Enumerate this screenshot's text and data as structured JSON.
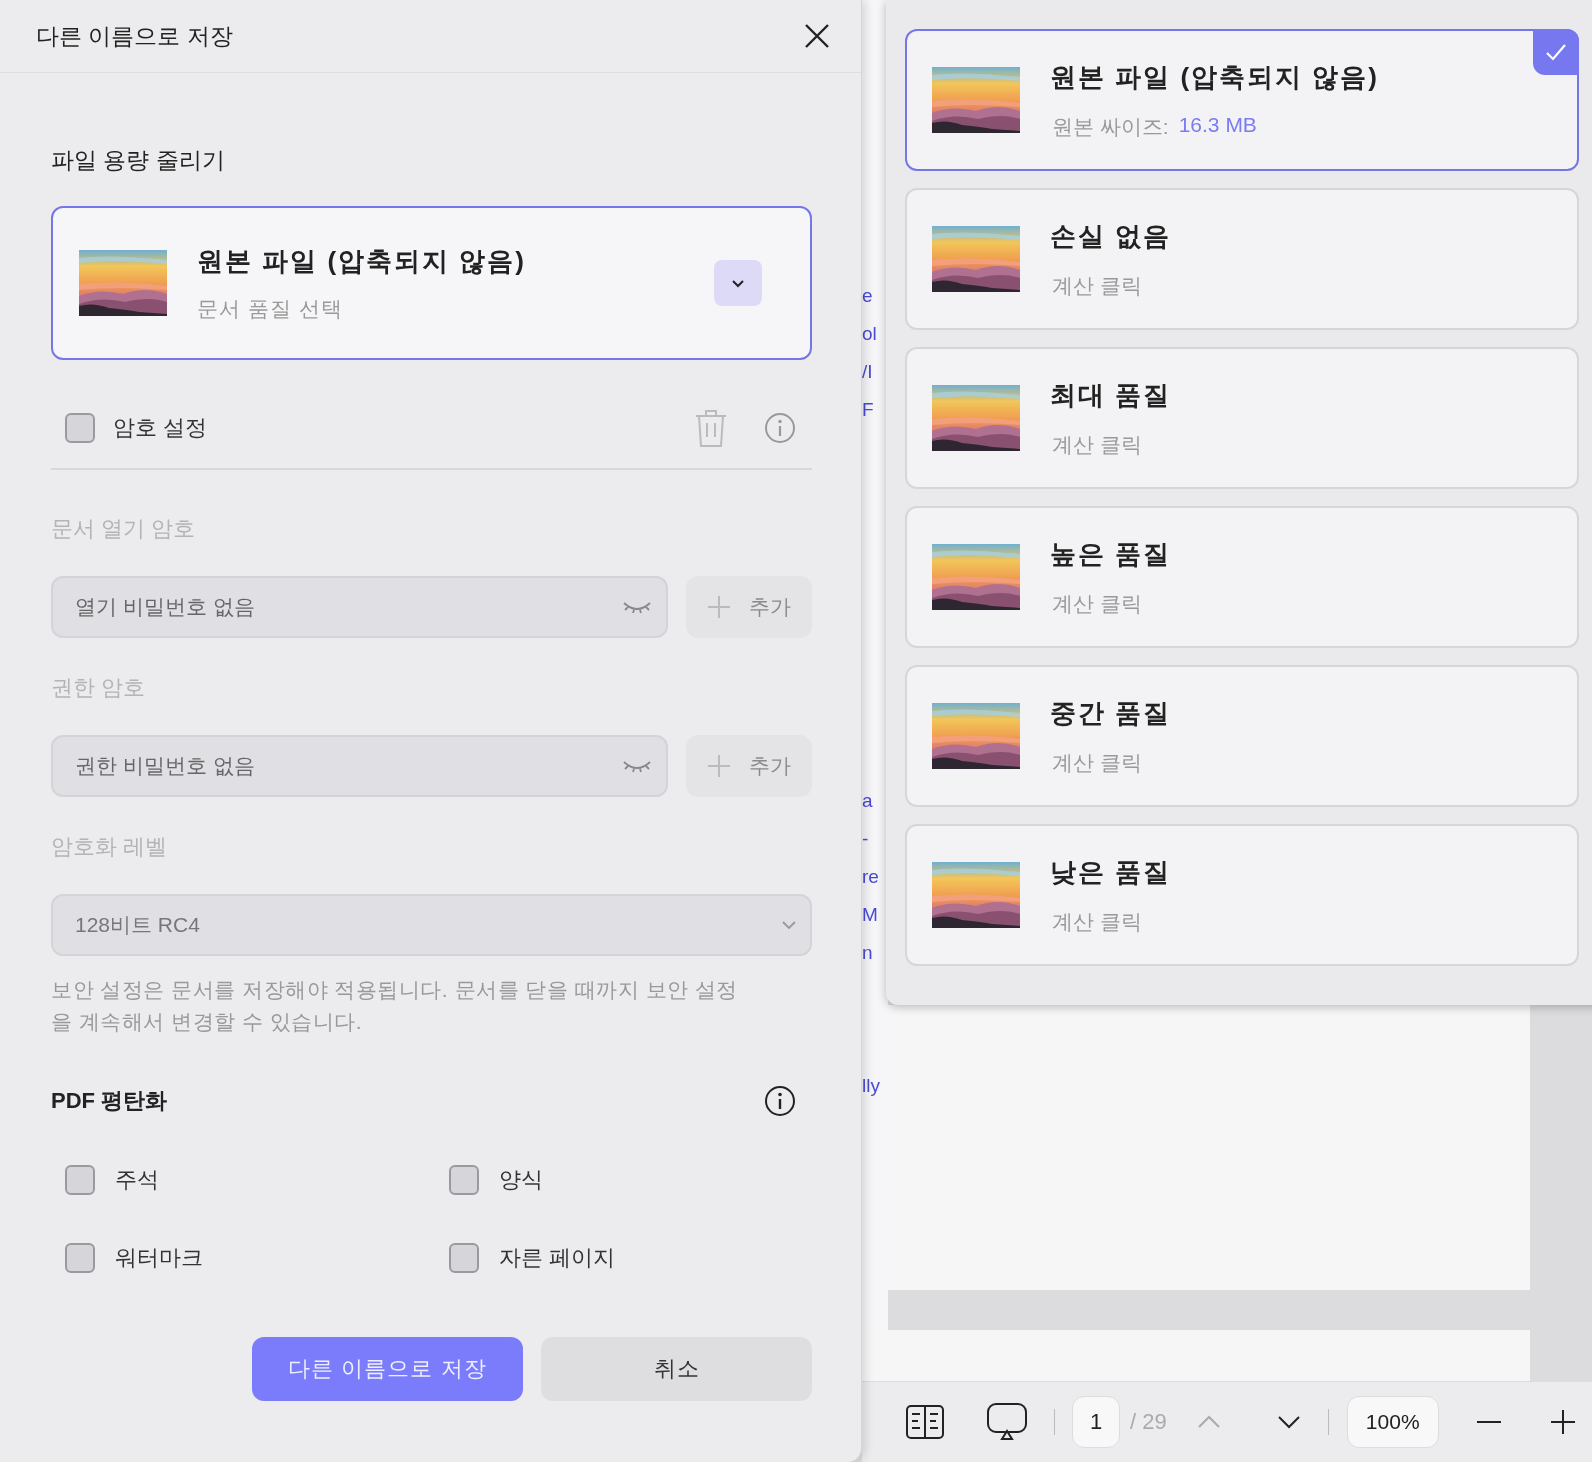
{
  "dialog": {
    "title": "다른 이름으로 저장",
    "compress": {
      "label": "파일 용량 줄리기",
      "title": "원본 파일 (압축되지 않음)",
      "subtitle": "문서 품질 선택"
    },
    "password": {
      "label": "암호 설정",
      "checked": false,
      "open": {
        "label": "문서 열기 암호",
        "value": "열기 비밀번호 없음",
        "add": "추가"
      },
      "permission": {
        "label": "권한 암호",
        "value": "권한 비밀번호 없음",
        "add": "추가"
      },
      "encryption": {
        "label": "암호화 레벨",
        "value": "128비트 RC4"
      },
      "note": "보안 설정은 문서를 저장해야 적용됩니다. 문서를 닫을 때까지 보안 설정을 계속해서 변경할 수 있습니다."
    },
    "flatten": {
      "label": "PDF 평탄화",
      "options": [
        {
          "label": "주석",
          "checked": false
        },
        {
          "label": "양식",
          "checked": false
        },
        {
          "label": "워터마크",
          "checked": false
        },
        {
          "label": "자른 페이지",
          "checked": false
        }
      ]
    },
    "buttons": [
      {
        "label": "다른 이름으로 저장",
        "kind": "primary"
      },
      {
        "label": "취소",
        "kind": "secondary"
      }
    ]
  },
  "quality_menu": {
    "options": [
      {
        "title": "원본 파일 (압축되지 않음)",
        "detail": "원본 싸이즈:",
        "size": "16.3 MB",
        "selected": true
      },
      {
        "title": "손실 없음",
        "detail": "계산 클릭",
        "selected": false
      },
      {
        "title": "최대 품질",
        "detail": "계산 클릭",
        "selected": false
      },
      {
        "title": "높은 품질",
        "detail": "계산 클릭",
        "selected": false
      },
      {
        "title": "중간 품질",
        "detail": "계산 클릭",
        "selected": false
      },
      {
        "title": "낮은 품질",
        "detail": "계산 클릭",
        "selected": false
      }
    ]
  },
  "background": {
    "text_fragments": [
      [
        "e",
        "ol",
        "/I",
        "F"
      ],
      [
        "a",
        "-",
        "re",
        "M",
        "n"
      ],
      [
        "lly"
      ]
    ]
  },
  "toolbar": {
    "page": "1",
    "total": "/ 29",
    "zoom": "100%"
  }
}
